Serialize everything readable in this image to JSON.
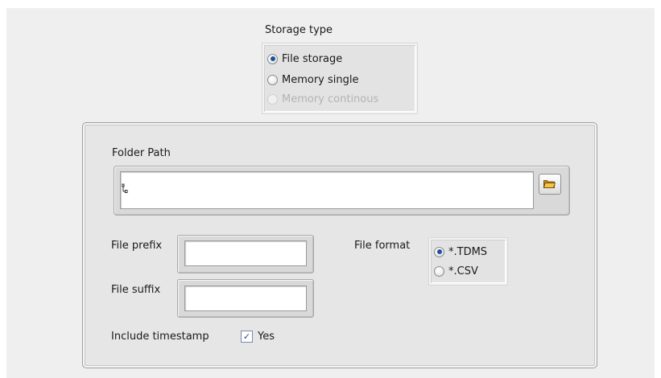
{
  "storage": {
    "label": "Storage type",
    "options": [
      {
        "label": "File storage",
        "selected": true,
        "enabled": true
      },
      {
        "label": "Memory single",
        "selected": false,
        "enabled": true
      },
      {
        "label": "Memory continous",
        "selected": false,
        "enabled": false
      }
    ]
  },
  "folder": {
    "label": "Folder Path",
    "value": "",
    "path_glyph": "␊",
    "browse_icon": "folder-open-icon"
  },
  "file_prefix": {
    "label": "File prefix",
    "value": ""
  },
  "file_suffix": {
    "label": "File suffix",
    "value": ""
  },
  "file_format": {
    "label": "File format",
    "options": [
      {
        "label": "*.TDMS",
        "selected": true
      },
      {
        "label": "*.CSV",
        "selected": false
      }
    ]
  },
  "timestamp": {
    "label": "Include timestamp",
    "checked": true,
    "option_label": "Yes"
  },
  "colors": {
    "accent": "#1e4fa0",
    "panel": "#efefef",
    "group": "#e6e6e6"
  }
}
